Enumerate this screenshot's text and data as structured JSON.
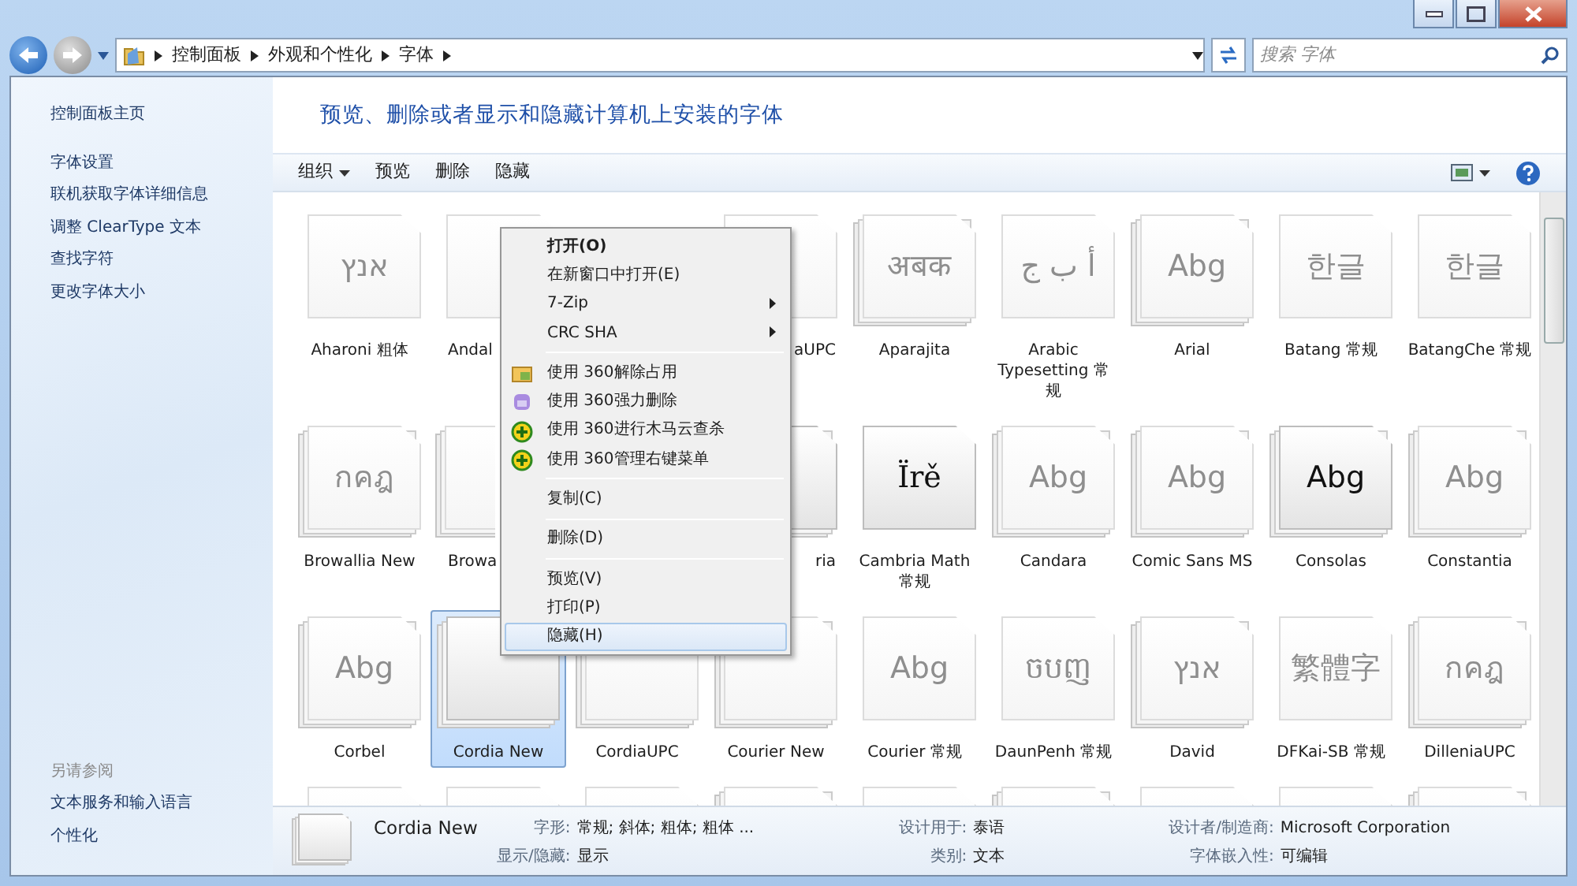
{
  "address_bar": {
    "breadcrumb": [
      "控制面板",
      "外观和个性化",
      "字体"
    ],
    "search_placeholder": "搜索 字体"
  },
  "sidebar": {
    "links": [
      "控制面板主页",
      "字体设置",
      "联机获取字体详细信息",
      "调整 ClearType 文本",
      "查找字符",
      "更改字体大小"
    ],
    "see_also_title": "另请参阅",
    "see_also": [
      "文本服务和输入语言",
      "个性化"
    ]
  },
  "header": {
    "title": "预览、删除或者显示和隐藏计算机上安装的字体"
  },
  "toolbar": {
    "items": [
      {
        "label": "组织",
        "dropdown": true
      },
      {
        "label": "预览",
        "dropdown": false
      },
      {
        "label": "删除",
        "dropdown": false
      },
      {
        "label": "隐藏",
        "dropdown": false
      }
    ]
  },
  "fonts": [
    {
      "kind": "font",
      "label": "Aharoni 粗体",
      "sample": "אנץ",
      "stacked": false,
      "hidden": true,
      "selected": false
    },
    {
      "kind": "font",
      "label": "Andal",
      "stacked": false,
      "hidden": true,
      "selected": false
    },
    {
      "kind": "covered"
    },
    {
      "kind": "font",
      "label": "aUPC",
      "stacked": false,
      "hidden": true,
      "selected": false
    },
    {
      "kind": "font",
      "label": "Aparajita",
      "sample": "अबक",
      "stacked": true,
      "hidden": true,
      "selected": false
    },
    {
      "kind": "font",
      "label": "Arabic Typesetting 常规",
      "sample": "أ ب ج",
      "stacked": false,
      "hidden": true,
      "selected": false
    },
    {
      "kind": "font",
      "label": "Arial",
      "sample": "Abg",
      "stacked": true,
      "hidden": true,
      "selected": false
    },
    {
      "kind": "font",
      "label": "Batang 常规",
      "sample": "한글",
      "stacked": false,
      "hidden": true,
      "selected": false
    },
    {
      "kind": "font",
      "label": "BatangChe 常规",
      "sample": "한글",
      "stacked": false,
      "hidden": true,
      "selected": false
    },
    {
      "kind": "font",
      "label": "Browallia New",
      "sample": "กคฎ",
      "stacked": true,
      "hidden": true,
      "selected": false
    },
    {
      "kind": "font",
      "label": "Browa",
      "stacked": true,
      "hidden": true,
      "selected": false
    },
    {
      "kind": "covered"
    },
    {
      "kind": "font",
      "label": "ria",
      "stacked": true,
      "hidden": false,
      "selected": false
    },
    {
      "kind": "font",
      "label": "Cambria Math 常规",
      "sample": "Ïrě",
      "stacked": false,
      "hidden": false,
      "selected": false
    },
    {
      "kind": "font",
      "label": "Candara",
      "sample": "Abg",
      "stacked": true,
      "hidden": true,
      "selected": false
    },
    {
      "kind": "font",
      "label": "Comic Sans MS",
      "sample": "Abg",
      "stacked": true,
      "hidden": true,
      "selected": false
    },
    {
      "kind": "font",
      "label": "Consolas",
      "sample": "Abg",
      "stacked": true,
      "hidden": false,
      "selected": false
    },
    {
      "kind": "font",
      "label": "Constantia",
      "sample": "Abg",
      "stacked": true,
      "hidden": true,
      "selected": false
    },
    {
      "kind": "font",
      "label": "Corbel",
      "sample": "Abg",
      "stacked": true,
      "hidden": true,
      "selected": false
    },
    {
      "kind": "font",
      "label": "Cordia New",
      "stacked": true,
      "hidden": false,
      "selected": true
    },
    {
      "kind": "font",
      "label": "CordiaUPC",
      "stacked": true,
      "hidden": true,
      "selected": false
    },
    {
      "kind": "font",
      "label": "Courier New",
      "stacked": true,
      "hidden": true,
      "selected": false
    },
    {
      "kind": "font",
      "label": "Courier 常规",
      "sample": "Abg",
      "stacked": false,
      "hidden": true,
      "selected": false
    },
    {
      "kind": "font",
      "label": "DaunPenh 常规",
      "sample": "ចបញ",
      "stacked": false,
      "hidden": true,
      "selected": false
    },
    {
      "kind": "font",
      "label": "David",
      "sample": "אנץ",
      "stacked": true,
      "hidden": true,
      "selected": false
    },
    {
      "kind": "font",
      "label": "DFKai-SB 常规",
      "sample": "繁體字",
      "stacked": false,
      "hidden": true,
      "selected": false
    },
    {
      "kind": "font",
      "label": "DilleniaUPC",
      "sample": "กคฎ",
      "stacked": true,
      "hidden": true,
      "selected": false
    },
    {
      "kind": "font",
      "stacked": false,
      "hidden": true,
      "selected": false
    },
    {
      "kind": "font",
      "stacked": false,
      "hidden": true,
      "selected": false
    },
    {
      "kind": "font",
      "stacked": false,
      "hidden": true,
      "selected": false
    },
    {
      "kind": "font",
      "stacked": true,
      "hidden": true,
      "selected": false
    },
    {
      "kind": "font",
      "stacked": false,
      "hidden": true,
      "selected": false
    },
    {
      "kind": "font",
      "stacked": true,
      "hidden": true,
      "selected": false
    },
    {
      "kind": "font",
      "stacked": false,
      "hidden": true,
      "selected": false
    },
    {
      "kind": "font",
      "stacked": false,
      "hidden": true,
      "selected": false
    },
    {
      "kind": "font",
      "stacked": true,
      "hidden": true,
      "selected": false
    }
  ],
  "context_menu": [
    {
      "kind": "item",
      "label": "打开(O)",
      "bold": true,
      "submenu": false,
      "highlighted": false
    },
    {
      "kind": "item",
      "label": "在新窗口中打开(E)",
      "bold": false,
      "submenu": false,
      "highlighted": false
    },
    {
      "kind": "item",
      "label": "7-Zip",
      "bold": false,
      "submenu": true,
      "highlighted": false
    },
    {
      "kind": "item",
      "label": "CRC SHA",
      "bold": false,
      "submenu": true,
      "highlighted": false
    },
    {
      "kind": "separator"
    },
    {
      "kind": "item",
      "label": "使用 360解除占用",
      "bold": false,
      "submenu": false,
      "highlighted": false
    },
    {
      "kind": "item",
      "label": "使用 360强力删除",
      "bold": false,
      "submenu": false,
      "highlighted": false
    },
    {
      "kind": "item",
      "label": "使用 360进行木马云查杀",
      "bold": false,
      "submenu": false,
      "highlighted": false
    },
    {
      "kind": "item",
      "label": "使用 360管理右键菜单",
      "bold": false,
      "submenu": false,
      "highlighted": false
    },
    {
      "kind": "separator"
    },
    {
      "kind": "item",
      "label": "复制(C)",
      "bold": false,
      "submenu": false,
      "highlighted": false
    },
    {
      "kind": "separator"
    },
    {
      "kind": "item",
      "label": "删除(D)",
      "bold": false,
      "submenu": false,
      "highlighted": false
    },
    {
      "kind": "separator"
    },
    {
      "kind": "item",
      "label": "预览(V)",
      "bold": false,
      "submenu": false,
      "highlighted": false
    },
    {
      "kind": "item",
      "label": "打印(P)",
      "bold": false,
      "submenu": false,
      "highlighted": false
    },
    {
      "kind": "item",
      "label": "隐藏(H)",
      "bold": false,
      "submenu": false,
      "highlighted": true
    }
  ],
  "details": {
    "name": "Cordia New",
    "fields": [
      {
        "label": "字形:",
        "value": "常规; 斜体; 粗体; 粗体 ..."
      },
      {
        "label": "设计用于:",
        "value": "泰语"
      },
      {
        "label": "设计者/制造商:",
        "value": "Microsoft Corporation"
      },
      {
        "label": "显示/隐藏:",
        "value": "显示"
      },
      {
        "label": "类别:",
        "value": "文本"
      },
      {
        "label": "字体嵌入性:",
        "value": "可编辑"
      }
    ]
  }
}
